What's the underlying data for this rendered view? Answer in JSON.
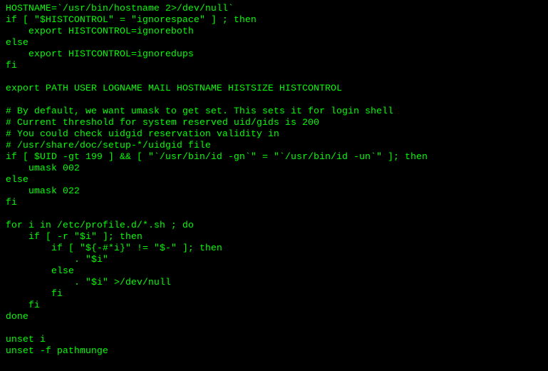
{
  "terminal": {
    "lines": [
      "HOSTNAME=`/usr/bin/hostname 2>/dev/null`",
      "if [ \"$HISTCONTROL\" = \"ignorespace\" ] ; then",
      "    export HISTCONTROL=ignoreboth",
      "else",
      "    export HISTCONTROL=ignoredups",
      "fi",
      "",
      "export PATH USER LOGNAME MAIL HOSTNAME HISTSIZE HISTCONTROL",
      "",
      "# By default, we want umask to get set. This sets it for login shell",
      "# Current threshold for system reserved uid/gids is 200",
      "# You could check uidgid reservation validity in",
      "# /usr/share/doc/setup-*/uidgid file",
      "if [ $UID -gt 199 ] && [ \"`/usr/bin/id -gn`\" = \"`/usr/bin/id -un`\" ]; then",
      "    umask 002",
      "else",
      "    umask 022",
      "fi",
      "",
      "for i in /etc/profile.d/*.sh ; do",
      "    if [ -r \"$i\" ]; then",
      "        if [ \"${-#*i}\" != \"$-\" ]; then",
      "            . \"$i\"",
      "        else",
      "            . \"$i\" >/dev/null",
      "        fi",
      "    fi",
      "done",
      "",
      "unset i",
      "unset -f pathmunge"
    ]
  }
}
